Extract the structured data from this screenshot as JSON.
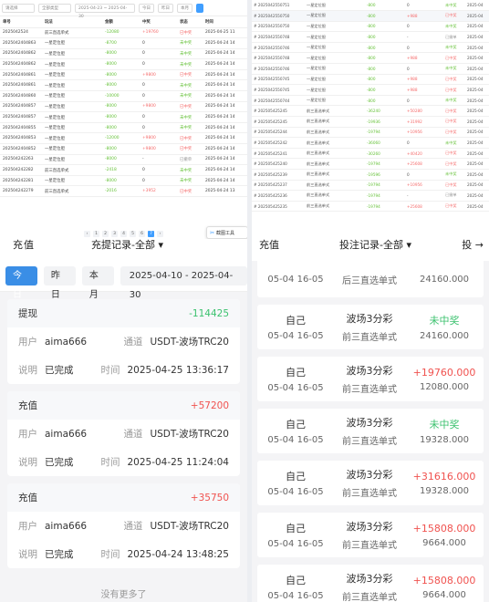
{
  "admin_left": {
    "filters": [
      "请选择",
      "全部类型",
      "2025-04-23",
      "2025-04-30",
      "今日",
      "昨日",
      "本月"
    ],
    "headers": [
      "单号",
      "玩法",
      "金额",
      "中奖",
      "状态",
      "时间"
    ],
    "rows": [
      [
        "2025042524",
        "前三直选单式",
        "-12080",
        "+19760",
        "已中奖",
        "2025-04-25 11"
      ],
      [
        "2025042404863",
        "一星定位胆",
        "-8700",
        "0",
        "未中奖",
        "2025-04-24 14"
      ],
      [
        "2025042404862",
        "一星定位胆",
        "-8000",
        "0",
        "未中奖",
        "2025-04-24 14"
      ],
      [
        "2025042404862",
        "一星定位胆",
        "-8000",
        "0",
        "未中奖",
        "2025-04-24 14"
      ],
      [
        "2025042404861",
        "一星定位胆",
        "-8000",
        "+9800",
        "已中奖",
        "2025-04-24 14"
      ],
      [
        "2025042404861",
        "一星定位胆",
        "-8000",
        "0",
        "未中奖",
        "2025-04-24 14"
      ],
      [
        "2025042404860",
        "一星定位胆",
        "-10000",
        "0",
        "未中奖",
        "2025-04-24 14"
      ],
      [
        "2025042404857",
        "一星定位胆",
        "-8000",
        "+9800",
        "已中奖",
        "2025-04-24 14"
      ],
      [
        "2025042404857",
        "一星定位胆",
        "-8000",
        "0",
        "未中奖",
        "2025-04-24 14"
      ],
      [
        "2025042404855",
        "一星定位胆",
        "-8000",
        "0",
        "未中奖",
        "2025-04-24 14"
      ],
      [
        "2025042404853",
        "一星定位胆",
        "-12000",
        "+9800",
        "已中奖",
        "2025-04-24 14"
      ],
      [
        "2025042404852",
        "一星定位胆",
        "-8000",
        "+9800",
        "已中奖",
        "2025-04-24 14"
      ],
      [
        "202504242263",
        "一星定位胆",
        "-8000",
        "-",
        "已撤单",
        "2025-04-24 14"
      ],
      [
        "202504242282",
        "前三直选单式",
        "-2418",
        "0",
        "未中奖",
        "2025-04-24 14"
      ],
      [
        "202504242281",
        "一星定位胆",
        "-8000",
        "0",
        "未中奖",
        "2025-04-24 14"
      ],
      [
        "202504242279",
        "前三直选单式",
        "-2016",
        "+3952",
        "已中奖",
        "2025-04-24 13"
      ]
    ],
    "pager": [
      "‹",
      "1",
      "2",
      "3",
      "4",
      "5",
      "6",
      "7",
      "›"
    ],
    "active_page": "7",
    "screenshot_label": "截图工具"
  },
  "admin_right": {
    "rows": [
      [
        "# 2025042550751",
        "一星定位胆",
        "-800",
        "0",
        "未中奖",
        "2025-04"
      ],
      [
        "# 2025042550750",
        "一星定位胆",
        "-800",
        "+988",
        "已中奖",
        "2025-04"
      ],
      [
        "# 2025042550750",
        "一星定位胆",
        "-800",
        "0",
        "未中奖",
        "2025-04"
      ],
      [
        "# 2025042550748",
        "一星定位胆",
        "-800",
        "-",
        "已撤单",
        "2025-04"
      ],
      [
        "# 2025042550746",
        "一星定位胆",
        "-800",
        "0",
        "未中奖",
        "2025-04"
      ],
      [
        "# 2025042550748",
        "一星定位胆",
        "-800",
        "+988",
        "已中奖",
        "2025-04"
      ],
      [
        "# 2025042550746",
        "一星定位胆",
        "-800",
        "0",
        "未中奖",
        "2025-04"
      ],
      [
        "# 2025042550745",
        "一星定位胆",
        "-800",
        "+988",
        "已中奖",
        "2025-04"
      ],
      [
        "# 2025042550745",
        "一星定位胆",
        "-800",
        "+988",
        "已中奖",
        "2025-04"
      ],
      [
        "# 2025042550744",
        "一星定位胆",
        "-800",
        "0",
        "未中奖",
        "2025-04"
      ],
      [
        "# 202505425245",
        "前三直选单式",
        "-36240",
        "+50280",
        "已中奖",
        "2025-04"
      ],
      [
        "# 202505425245",
        "前三直选单式",
        "-19936",
        "+31992",
        "已中奖",
        "2025-04"
      ],
      [
        "# 202505425244",
        "前三直选单式",
        "-19794",
        "+10956",
        "已中奖",
        "2025-04"
      ],
      [
        "# 202505425242",
        "前三直选单式",
        "-36060",
        "0",
        "未中奖",
        "2025-04"
      ],
      [
        "# 202505425241",
        "前三直选单式",
        "-30260",
        "+40420",
        "已中奖",
        "2025-04"
      ],
      [
        "# 202505425240",
        "前三直选单式",
        "-19794",
        "+25608",
        "已中奖",
        "2025-04"
      ],
      [
        "# 202505425239",
        "前三直选单式",
        "-19596",
        "0",
        "未中奖",
        "2025-04"
      ],
      [
        "# 202505425237",
        "前三直选单式",
        "-19794",
        "+10956",
        "已中奖",
        "2025-04"
      ],
      [
        "# 202505425236",
        "前三直选单式",
        "-19794",
        "-",
        "已撤单",
        "2025-04"
      ],
      [
        "# 202505425235",
        "前三直选单式",
        "-19794",
        "+25608",
        "已中奖",
        "2025-04"
      ]
    ]
  },
  "mobile_left": {
    "header_left": "充值",
    "header_title": "充提记录-全部 ▾",
    "tabs": [
      "今日",
      "昨日",
      "本月"
    ],
    "date_range": "2025-04-10  -  2025-04-30",
    "label_user": "用户",
    "label_channel": "通道",
    "label_note": "说明",
    "label_time": "时间",
    "records": [
      {
        "type": "提现",
        "amount": "-114425",
        "user": "aima666",
        "channel": "USDT-波场TRC20",
        "note": "已完成",
        "time": "2025-04-25 13:36:17"
      },
      {
        "type": "充值",
        "amount": "+57200",
        "user": "aima666",
        "channel": "USDT-波场TRC20",
        "note": "已完成",
        "time": "2025-04-25 11:24:04"
      },
      {
        "type": "充值",
        "amount": "+35750",
        "user": "aima666",
        "channel": "USDT-波场TRC20",
        "note": "已完成",
        "time": "2025-04-24 13:48:25"
      }
    ],
    "no_more": "没有更多了"
  },
  "mobile_right": {
    "header_left": "充值",
    "header_title": "投注记录-全部 ▾",
    "header_right": "投 →",
    "bets": [
      {
        "who": "",
        "date": "05-04 16-05",
        "game": "",
        "mode": "后三直选单式",
        "result": "",
        "amount": "24160.000"
      },
      {
        "who": "自己",
        "date": "05-04 16-05",
        "game": "波场3分彩",
        "mode": "前三直选单式",
        "result": "未中奖",
        "amount": "24160.000"
      },
      {
        "who": "自己",
        "date": "05-04 16-05",
        "game": "波场3分彩",
        "mode": "前三直选单式",
        "result": "+19760.000",
        "amount": "12080.000"
      },
      {
        "who": "自己",
        "date": "05-04 16-05",
        "game": "波场3分彩",
        "mode": "前三直选单式",
        "result": "未中奖",
        "amount": "19328.000"
      },
      {
        "who": "自己",
        "date": "05-04 16-05",
        "game": "波场3分彩",
        "mode": "前三直选单式",
        "result": "+31616.000",
        "amount": "19328.000"
      },
      {
        "who": "自己",
        "date": "05-04 16-05",
        "game": "波场3分彩",
        "mode": "前三直选单式",
        "result": "+15808.000",
        "amount": "9664.000"
      },
      {
        "who": "自己",
        "date": "05-04 16-05",
        "game": "波场3分彩",
        "mode": "前三直选单式",
        "result": "+15808.000",
        "amount": "9664.000"
      }
    ]
  },
  "colors": {
    "win_red": "#f0524f",
    "lose_green": "#3cc26f",
    "accent_blue": "#3a8ee6"
  }
}
